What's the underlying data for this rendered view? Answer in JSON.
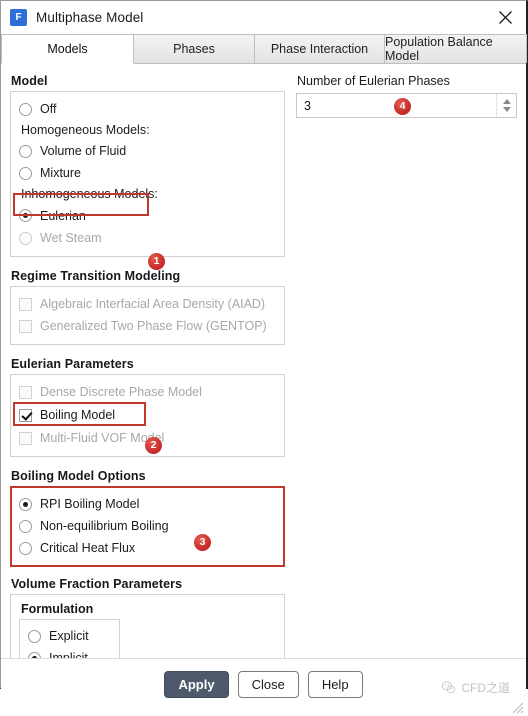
{
  "window": {
    "title": "Multiphase Model",
    "icon": "fluent-app-icon",
    "icon_letter": "F",
    "close_label": "close-icon"
  },
  "tabs": [
    {
      "label": "Models",
      "active": true
    },
    {
      "label": "Phases",
      "active": false
    },
    {
      "label": "Phase Interaction",
      "active": false
    },
    {
      "label": "Population Balance Model",
      "active": false
    }
  ],
  "model_group": {
    "title": "Model",
    "off": {
      "label": "Off",
      "checked": false,
      "disabled": false
    },
    "homogeneous_header": "Homogeneous Models:",
    "volume_of_fluid": {
      "label": "Volume of Fluid",
      "checked": false,
      "disabled": false
    },
    "mixture": {
      "label": "Mixture",
      "checked": false,
      "disabled": false
    },
    "inhomogeneous_header": "Inhomogeneous Models:",
    "eulerian": {
      "label": "Eulerian",
      "checked": true,
      "disabled": false
    },
    "wet_steam": {
      "label": "Wet Steam",
      "checked": false,
      "disabled": true
    }
  },
  "regime_group": {
    "title": "Regime Transition Modeling",
    "aiad": {
      "label": "Algebraic Interfacial Area Density (AIAD)",
      "checked": false,
      "disabled": true
    },
    "gentop": {
      "label": "Generalized Two Phase Flow (GENTOP)",
      "checked": false,
      "disabled": true
    }
  },
  "eulerian_params_group": {
    "title": "Eulerian Parameters",
    "ddpm": {
      "label": "Dense Discrete Phase Model",
      "checked": false,
      "disabled": true
    },
    "boiling": {
      "label": "Boiling Model",
      "checked": true,
      "disabled": false
    },
    "mfvof": {
      "label": "Multi-Fluid VOF Model",
      "checked": false,
      "disabled": true
    }
  },
  "boiling_options_group": {
    "title": "Boiling Model Options",
    "rpi": {
      "label": "RPI Boiling Model",
      "checked": true
    },
    "noneq": {
      "label": "Non-equilibrium Boiling",
      "checked": false
    },
    "chf": {
      "label": "Critical Heat Flux",
      "checked": false
    }
  },
  "volume_fraction_group": {
    "title": "Volume Fraction Parameters",
    "formulation_title": "Formulation",
    "explicit": {
      "label": "Explicit",
      "checked": false
    },
    "implicit": {
      "label": "Implicit",
      "checked": true
    }
  },
  "right_panel": {
    "phases_label": "Number of Eulerian Phases",
    "phases_value": "3",
    "spin_up": "spinner-up-icon",
    "spin_down": "spinner-down-icon"
  },
  "annotations": {
    "badge1": "1",
    "badge2": "2",
    "badge3": "3",
    "badge4": "4",
    "color": "#c0392b"
  },
  "footer": {
    "apply": "Apply",
    "close": "Close",
    "help": "Help",
    "watermark": "CFD之道"
  }
}
